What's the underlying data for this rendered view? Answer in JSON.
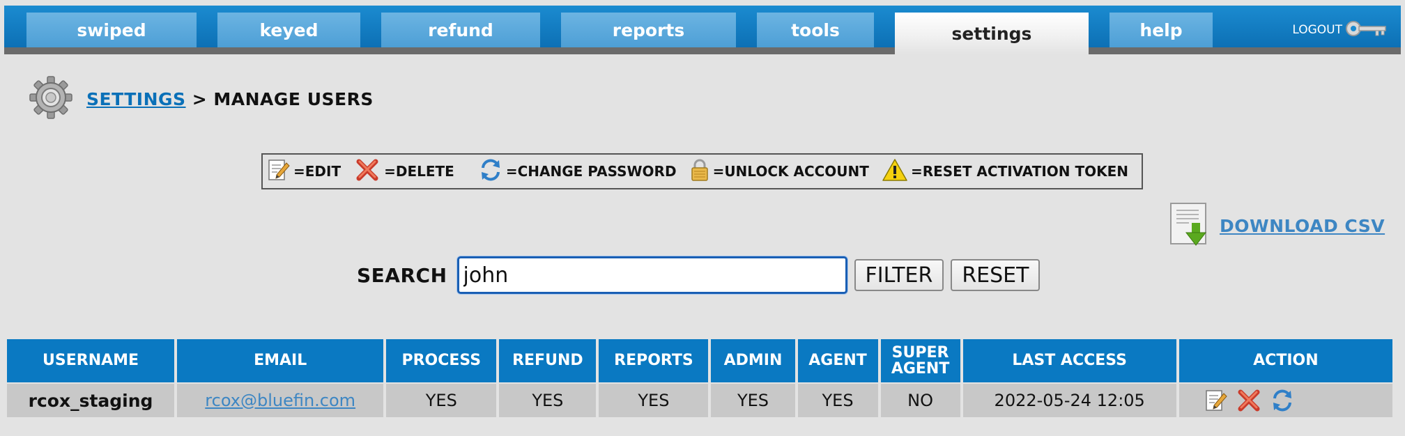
{
  "nav": {
    "tabs": [
      {
        "label": "swiped"
      },
      {
        "label": "keyed"
      },
      {
        "label": "refund"
      },
      {
        "label": "reports"
      },
      {
        "label": "tools"
      },
      {
        "label": "settings",
        "active": true
      },
      {
        "label": "help"
      }
    ],
    "logout_label": "LOGOUT"
  },
  "breadcrumb": {
    "root_label": "SETTINGS",
    "separator": ">",
    "current": "MANAGE USERS"
  },
  "legend": {
    "edit": "=EDIT",
    "delete": "=DELETE",
    "change_password": "=CHANGE PASSWORD",
    "unlock": "=UNLOCK ACCOUNT",
    "reset_token": "=RESET ACTIVATION TOKEN"
  },
  "download": {
    "label": "DOWNLOAD CSV"
  },
  "search": {
    "label": "SEARCH",
    "value": "john",
    "filter_label": "FILTER",
    "reset_label": "RESET"
  },
  "table": {
    "columns": [
      "USERNAME",
      "EMAIL",
      "PROCESS",
      "REFUND",
      "REPORTS",
      "ADMIN",
      "AGENT",
      "SUPER AGENT",
      "LAST ACCESS",
      "ACTION"
    ],
    "rows": [
      {
        "username": "rcox_staging",
        "email": "rcox@bluefin.com",
        "process": "YES",
        "refund": "YES",
        "reports": "YES",
        "admin": "YES",
        "agent": "YES",
        "super_agent": "NO",
        "last_access": "2022-05-24 12:05"
      }
    ]
  },
  "colors": {
    "nav_blue": "#0c6fb4",
    "tab_blue": "#5aa7da",
    "header_blue": "#0a79c2",
    "link_blue": "#3d86c3",
    "background": "#e3e3e3",
    "row_gray": "#c8c8c8"
  }
}
